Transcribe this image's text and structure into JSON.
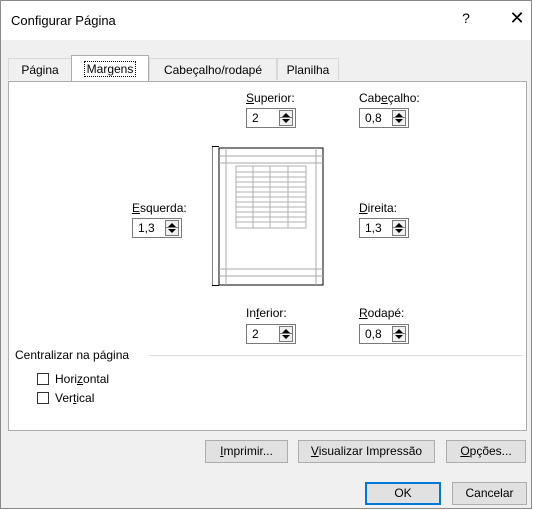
{
  "window": {
    "title": "Configurar Página",
    "help_label": "?",
    "close_label": "✕"
  },
  "tabs": [
    {
      "label": "Página",
      "active": false
    },
    {
      "label": "Margens",
      "active": true
    },
    {
      "label": "Cabeçalho/rodapé",
      "active": false
    },
    {
      "label": "Planilha",
      "active": false
    }
  ],
  "margins": {
    "top": {
      "label": "Superior:",
      "value": "2"
    },
    "header": {
      "label": "Cabeçalho:",
      "value": "0,8"
    },
    "left": {
      "label": "Esquerda:",
      "value": "1,3"
    },
    "right": {
      "label": "Direita:",
      "value": "1,3"
    },
    "bottom": {
      "label": "Inferior:",
      "value": "2"
    },
    "footer": {
      "label": "Rodapé:",
      "value": "0,8"
    }
  },
  "center": {
    "section_label": "Centralizar na página",
    "horizontal": {
      "label": "Horizontal",
      "checked": false
    },
    "vertical": {
      "label": "Vertical",
      "checked": false
    }
  },
  "buttons": {
    "print": "Imprimir...",
    "preview": "Visualizar Impressão",
    "options": "Opções...",
    "ok": "OK",
    "cancel": "Cancelar"
  },
  "colors": {
    "accent": "#0078d7",
    "dialog_bg": "#f0f0f0",
    "panel_bg": "#ffffff"
  }
}
